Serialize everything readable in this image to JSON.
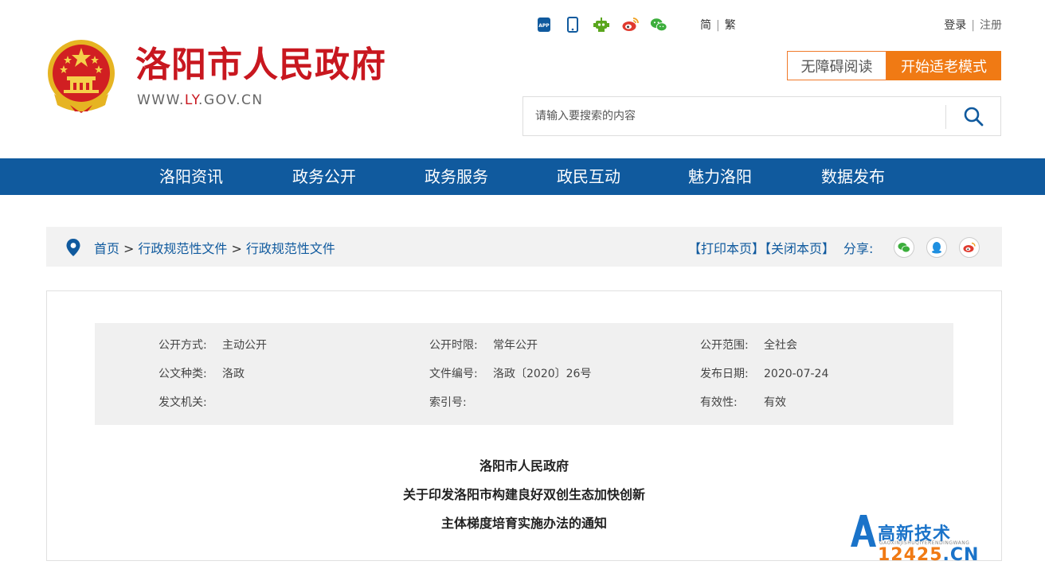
{
  "header": {
    "site_title": "洛阳市人民政府",
    "url_prefix": "WWW.",
    "url_highlight": "LY",
    "url_suffix": ".GOV.CN",
    "top_icons": [
      "app-icon",
      "mobile-icon",
      "robot-icon",
      "weibo-icon",
      "wechat-icon"
    ],
    "lang_simplified": "简",
    "lang_traditional": "繁",
    "lang_sep": "|",
    "login": "登录",
    "auth_sep": "|",
    "register": "注册",
    "accessibility_button": "无障碍阅读",
    "elder_mode_button": "开始适老模式",
    "search_placeholder": "请输入要搜索的内容"
  },
  "nav": {
    "items": [
      "洛阳资讯",
      "政务公开",
      "政务服务",
      "政民互动",
      "魅力洛阳",
      "数据发布"
    ]
  },
  "breadcrumb": {
    "items": [
      "首页",
      "行政规范性文件",
      "行政规范性文件"
    ],
    "sep": ">",
    "print": "【打印本页】",
    "close": "【关闭本页】",
    "share_label": "分享:",
    "share_icons": [
      "wechat-icon",
      "qq-icon",
      "weibo-icon"
    ]
  },
  "meta": {
    "rows": [
      [
        {
          "label": "公开方式:",
          "value": "主动公开"
        },
        {
          "label": "公开时限:",
          "value": "常年公开"
        },
        {
          "label": "公开范围:",
          "value": "全社会"
        }
      ],
      [
        {
          "label": "公文种类:",
          "value": "洛政"
        },
        {
          "label": "文件编号:",
          "value": "洛政〔2020〕26号"
        },
        {
          "label": "发布日期:",
          "value": "2020-07-24"
        }
      ],
      [
        {
          "label": "发文机关:",
          "value": ""
        },
        {
          "label": "索引号:",
          "value": ""
        },
        {
          "label": "有效性:",
          "value": "有效"
        }
      ]
    ]
  },
  "document": {
    "title_lines": [
      "洛阳市人民政府",
      "关于印发洛阳市构建良好双创生态加快创新",
      "主体梯度培育实施办法的通知"
    ]
  },
  "watermark": {
    "brand": "高新技术",
    "domain": "12425",
    "tld": ".CN",
    "sub": "GAOXINJISHUQIYERENDINGWANG"
  },
  "colors": {
    "brand_red": "#c8171f",
    "nav_blue": "#105a9e",
    "accent_orange": "#f07a14"
  }
}
